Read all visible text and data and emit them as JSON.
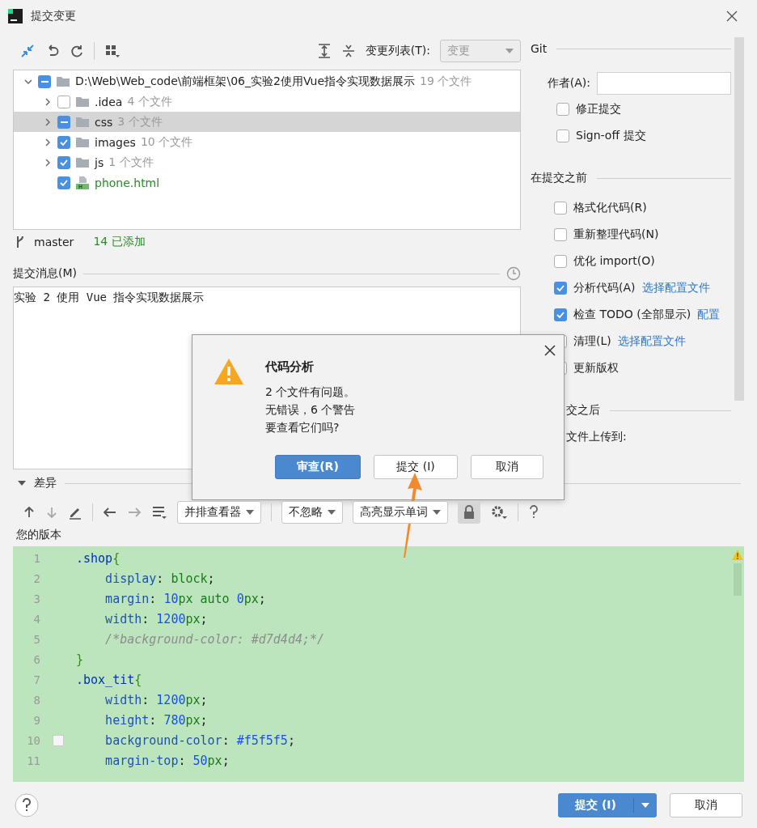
{
  "window": {
    "title": "提交变更"
  },
  "toolbar": {
    "changelist_label": "变更列表(T):",
    "changelist_value": "变更"
  },
  "tree": [
    {
      "name": "D:\\Web\\Web_code\\前端框架\\06_实验2使用Vue指令实现数据展示",
      "count": "19 个文件",
      "kind": "folder",
      "checked": true,
      "partial": true,
      "expanded": true,
      "selected": false,
      "children": [
        {
          "name": ".idea",
          "count": "4 个文件",
          "kind": "folder",
          "checked": false,
          "partial": false,
          "expanded": false,
          "selected": false
        },
        {
          "name": "css",
          "count": "3 个文件",
          "kind": "folder",
          "checked": true,
          "partial": true,
          "expanded": false,
          "selected": true
        },
        {
          "name": "images",
          "count": "10 个文件",
          "kind": "folder",
          "checked": true,
          "partial": false,
          "expanded": false,
          "selected": false
        },
        {
          "name": "js",
          "count": "1 个文件",
          "kind": "folder",
          "checked": true,
          "partial": false,
          "expanded": false,
          "selected": false
        },
        {
          "name": "phone.html",
          "kind": "html",
          "checked": true,
          "partial": false,
          "selected": false
        }
      ]
    }
  ],
  "branch": {
    "name": "master",
    "added": "14 已添加"
  },
  "message": {
    "label": "提交消息(M)",
    "value": "实验 2 使用 Vue 指令实现数据展示"
  },
  "git": {
    "title": "Git",
    "author_label": "作者(A):",
    "options": [
      {
        "label": "修正提交",
        "checked": false
      },
      {
        "label": "Sign-off 提交",
        "checked": false
      }
    ]
  },
  "before_commit": {
    "title": "在提交之前",
    "options": [
      {
        "label": "格式化代码(R)",
        "checked": false
      },
      {
        "label": "重新整理代码(N)",
        "checked": false
      },
      {
        "label": "优化 import(O)",
        "checked": false
      },
      {
        "label": "分析代码(A)",
        "checked": true,
        "link": "选择配置文件"
      },
      {
        "label": "检查 TODO (全部显示)",
        "checked": true,
        "link": "配置"
      },
      {
        "label": "清理(L)",
        "checked": false,
        "link": "选择配置文件"
      },
      {
        "label": "更新版权",
        "checked": false
      }
    ]
  },
  "after_commit": {
    "title": "交之后",
    "option": "文件上传到:"
  },
  "diff": {
    "title": "差异",
    "expanded": true,
    "viewer": "并排查看器",
    "ignore": "不忽略",
    "highlight": "高亮显示单词",
    "version_label": "您的版本"
  },
  "code": [
    {
      "n": "1",
      "tokens": [
        {
          "t": ".shop",
          "kind": "sel"
        },
        {
          "t": "{",
          "kind": "brace"
        }
      ]
    },
    {
      "n": "2",
      "tokens": [
        {
          "t": "    display",
          "kind": "prop"
        },
        {
          "t": ": ",
          "kind": "punct"
        },
        {
          "t": "block",
          "kind": "val"
        },
        {
          "t": ";",
          "kind": "punct"
        }
      ]
    },
    {
      "n": "3",
      "tokens": [
        {
          "t": "    margin",
          "kind": "prop"
        },
        {
          "t": ": ",
          "kind": "punct"
        },
        {
          "t": "10",
          "kind": "num"
        },
        {
          "t": "px auto ",
          "kind": "val"
        },
        {
          "t": "0",
          "kind": "num"
        },
        {
          "t": "px",
          "kind": "val"
        },
        {
          "t": ";",
          "kind": "punct"
        }
      ]
    },
    {
      "n": "4",
      "tokens": [
        {
          "t": "    width",
          "kind": "prop"
        },
        {
          "t": ": ",
          "kind": "punct"
        },
        {
          "t": "1200",
          "kind": "num"
        },
        {
          "t": "px",
          "kind": "val"
        },
        {
          "t": ";",
          "kind": "punct"
        }
      ]
    },
    {
      "n": "5",
      "tokens": [
        {
          "t": "    /*background-color: #d7d4d4;*/",
          "kind": "comment"
        }
      ]
    },
    {
      "n": "6",
      "tokens": [
        {
          "t": "}",
          "kind": "brace"
        }
      ]
    },
    {
      "n": "7",
      "tokens": [
        {
          "t": ".box_tit",
          "kind": "sel"
        },
        {
          "t": "{",
          "kind": "brace"
        }
      ]
    },
    {
      "n": "8",
      "tokens": [
        {
          "t": "    width",
          "kind": "prop"
        },
        {
          "t": ": ",
          "kind": "punct"
        },
        {
          "t": "1200",
          "kind": "num"
        },
        {
          "t": "px",
          "kind": "val"
        },
        {
          "t": ";",
          "kind": "punct"
        }
      ]
    },
    {
      "n": "9",
      "tokens": [
        {
          "t": "    height",
          "kind": "prop"
        },
        {
          "t": ": ",
          "kind": "punct"
        },
        {
          "t": "780",
          "kind": "num"
        },
        {
          "t": "px",
          "kind": "val"
        },
        {
          "t": ";",
          "kind": "punct"
        }
      ]
    },
    {
      "n": "10",
      "swatch": true,
      "tokens": [
        {
          "t": "    background-color",
          "kind": "prop"
        },
        {
          "t": ": ",
          "kind": "punct"
        },
        {
          "t": "#f5f5f5",
          "kind": "num"
        },
        {
          "t": ";",
          "kind": "punct"
        }
      ]
    },
    {
      "n": "11",
      "tokens": [
        {
          "t": "    margin-top",
          "kind": "prop"
        },
        {
          "t": ": ",
          "kind": "punct"
        },
        {
          "t": "50",
          "kind": "num"
        },
        {
          "t": "px",
          "kind": "val"
        },
        {
          "t": ";",
          "kind": "punct"
        }
      ]
    }
  ],
  "footer": {
    "commit": "提交 (I)",
    "cancel": "取消"
  },
  "dialog": {
    "title": "代码分析",
    "lines": [
      "2 个文件有问题。",
      "无错误，6 个警告",
      "要查看它们吗?"
    ],
    "buttons": [
      {
        "label": "审查(R)",
        "kind": "primary"
      },
      {
        "label": "提交 (I)",
        "kind": "normal"
      },
      {
        "label": "取消",
        "kind": "normal"
      }
    ]
  }
}
